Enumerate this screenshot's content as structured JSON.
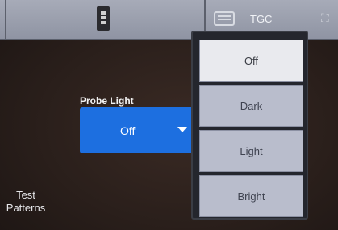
{
  "toolbar": {
    "probe_icon": "probe-icon",
    "keyboard_icon": "keyboard-icon",
    "tgc_label": "TGC",
    "expand_icon": "expand-icon"
  },
  "probe_light": {
    "label": "Probe Light",
    "selected_value": "Off",
    "options": [
      "Off",
      "Dark",
      "Light",
      "Bright"
    ]
  },
  "test_patterns": {
    "line1": "Test",
    "line2": "Patterns"
  },
  "colors": {
    "select_accent": "#1d6fe0",
    "option_bg": "#b9bdcc",
    "option_selected_bg": "#e9eaee"
  }
}
